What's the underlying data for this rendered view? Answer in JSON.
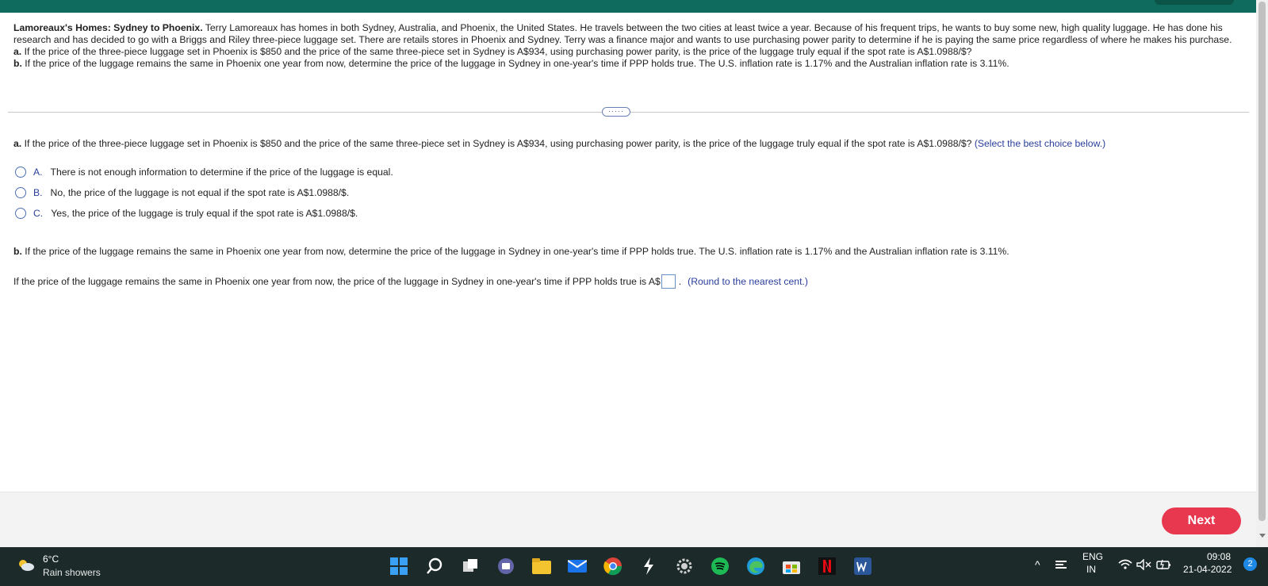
{
  "problem": {
    "title": "Lamoreaux's Homes: Sydney to Phoenix.",
    "body": "Terry Lamoreaux has homes in both Sydney, Australia, and Phoenix, the United States. He travels between the two cities at least twice a year. Because of his frequent trips, he wants to buy some new, high quality luggage. He has done his research and has decided to go with a Briggs and Riley three-piece luggage set. There are retails stores in Phoenix and Sydney. Terry was a finance major and wants to use purchasing power parity to determine if he is paying the same price regardless of where he makes his purchase.",
    "part_a_label": "a.",
    "part_a": "If the price of the three-piece luggage set in Phoenix is $850 and the price of the same three-piece set in Sydney is A$934, using purchasing power parity, is the price of the luggage truly equal if the spot rate is A$1.0988/$?",
    "part_b_label": "b.",
    "part_b": "If the price of the luggage remains the same in Phoenix one year from now, determine the price of the luggage in Sydney in one-year's time if PPP holds true. The U.S. inflation rate is 1.17% and the Australian inflation rate is 3.11%."
  },
  "more_button": "·····",
  "question_a": {
    "label": "a.",
    "text": "If the price of the three-piece luggage set in Phoenix is $850 and the price of the same three-piece set in Sydney is A$934, using purchasing power parity, is the price of the luggage truly equal if the spot rate is A$1.0988/$?",
    "hint": "(Select the best choice below.)",
    "choices": [
      {
        "letter": "A.",
        "text": "There is not enough information to determine if the price of the luggage is equal."
      },
      {
        "letter": "B.",
        "text": "No, the price of the luggage is not equal if the spot rate is A$1.0988/$."
      },
      {
        "letter": "C.",
        "text": "Yes, the price of the luggage is truly equal if the spot rate is A$1.0988/$."
      }
    ]
  },
  "question_b": {
    "label": "b.",
    "text": "If the price of the luggage remains the same in Phoenix one year from now, determine the price of the luggage in Sydney in one-year's time if PPP holds true. The U.S. inflation rate is 1.17% and the Australian inflation rate is 3.11%.",
    "answer_prefix": "If the price of the luggage remains the same in Phoenix one year from now, the price of the luggage in Sydney in one-year's time if PPP holds true is A$",
    "answer_value": "",
    "answer_suffix": ".",
    "hint": "(Round to the nearest cent.)"
  },
  "footer": {
    "next_label": "Next"
  },
  "taskbar": {
    "weather_temp": "6°C",
    "weather_desc": "Rain showers",
    "lang_top": "ENG",
    "lang_bottom": "IN",
    "time": "09:08",
    "date": "21-04-2022",
    "notification_count": "2",
    "icons": [
      "windows-start-icon",
      "search-icon",
      "task-view-icon",
      "teams-chat-icon",
      "file-explorer-icon",
      "mail-icon",
      "chrome-icon",
      "lightning-app-icon",
      "settings-icon",
      "spotify-icon",
      "edge-icon",
      "store-icon",
      "netflix-icon",
      "word-icon"
    ]
  },
  "colors": {
    "header": "#0f6b5e",
    "accent_blue": "#2a3f9b",
    "next_button": "#e8384f",
    "taskbar": "#1c2b2a"
  }
}
